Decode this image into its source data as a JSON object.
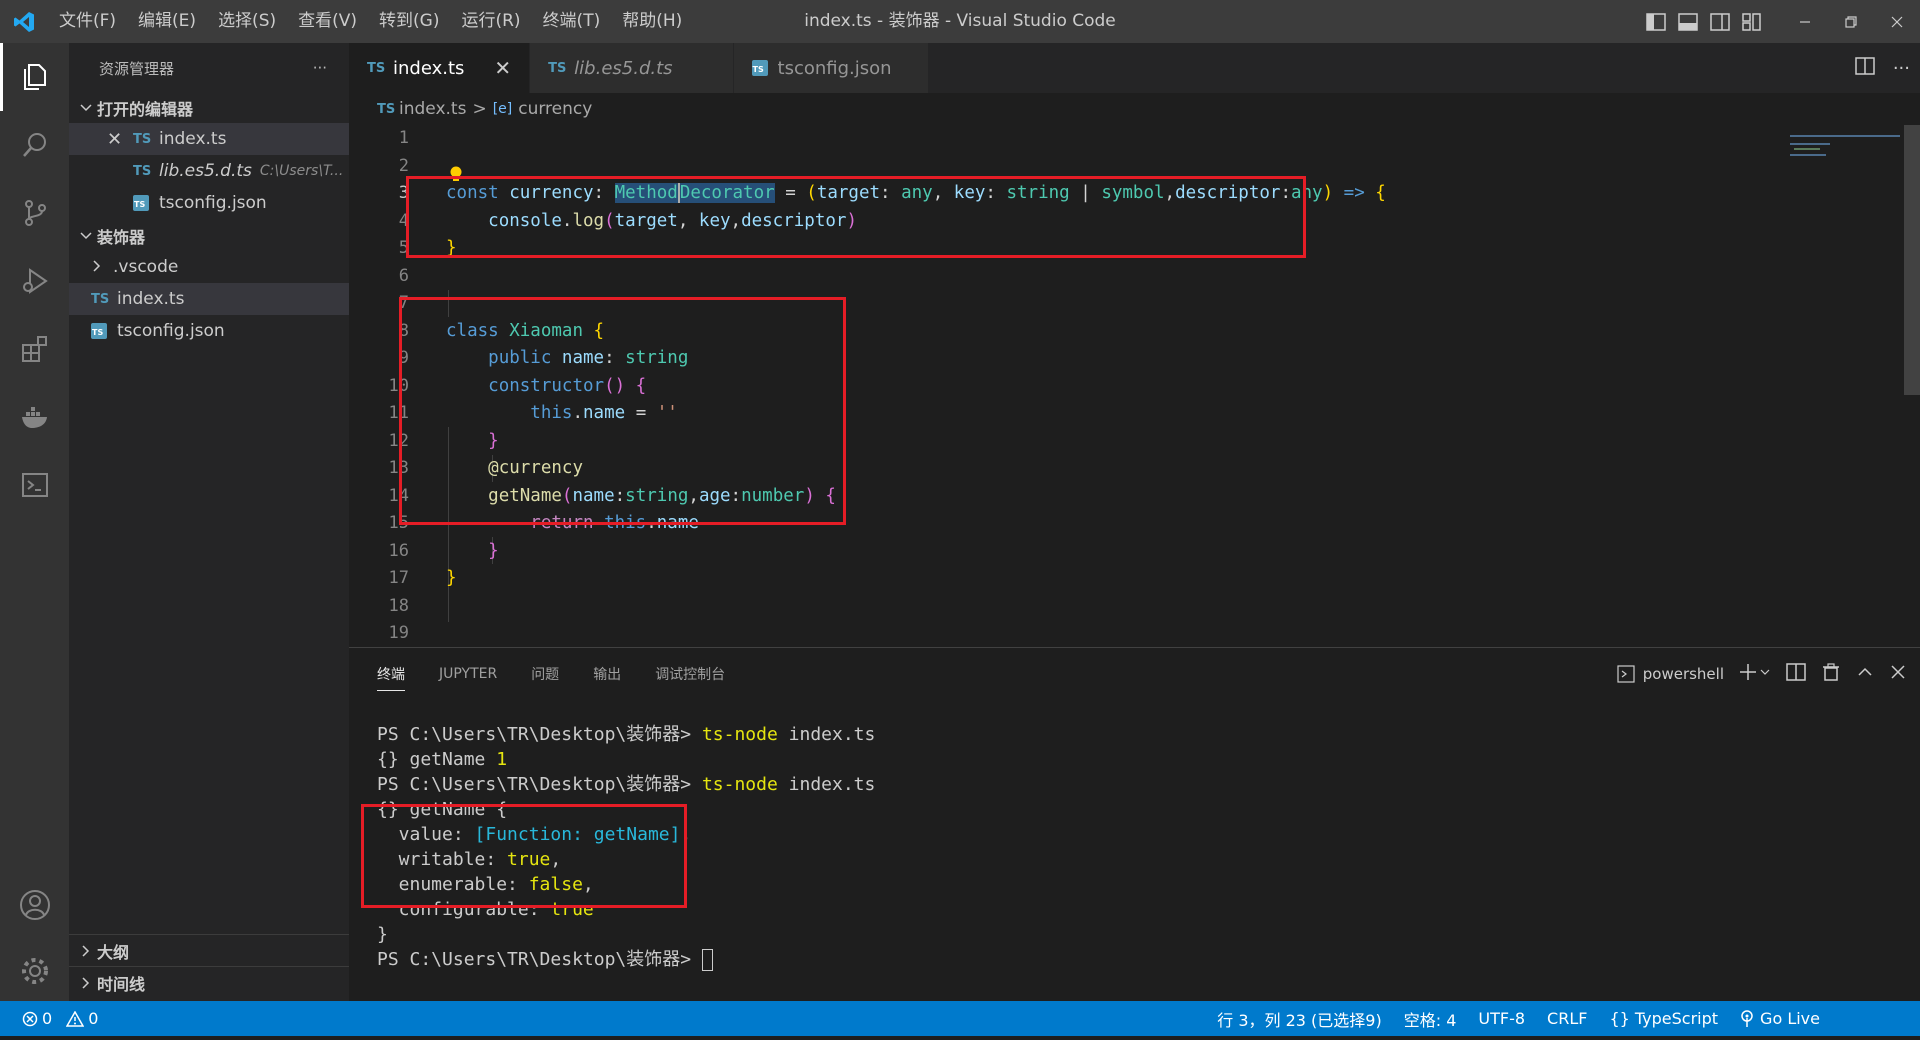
{
  "menu": [
    "文件(F)",
    "编辑(E)",
    "选择(S)",
    "查看(V)",
    "转到(G)",
    "运行(R)",
    "终端(T)",
    "帮助(H)"
  ],
  "window_title": "index.ts - 装饰器 - Visual Studio Code",
  "sidebar": {
    "title": "资源管理器",
    "more": "···",
    "open_editors": {
      "header": "打开的编辑器",
      "items": [
        {
          "badge": "TS",
          "name": "index.ts",
          "path": ""
        },
        {
          "badge": "TS",
          "name": "lib.es5.d.ts",
          "path": "C:\\Users\\T..."
        },
        {
          "badge": "",
          "name": "tsconfig.json",
          "path": ""
        }
      ]
    },
    "folder": {
      "header": "装饰器",
      "items": [
        {
          "badge": "",
          "name": ".vscode"
        },
        {
          "badge": "TS",
          "name": "index.ts"
        },
        {
          "badge": "",
          "name": "tsconfig.json"
        }
      ]
    },
    "outline": "大纲",
    "timeline": "时间线"
  },
  "tabs": [
    {
      "badge": "TS",
      "label": "index.ts",
      "close": "✕"
    },
    {
      "badge": "TS",
      "label": "lib.es5.d.ts"
    },
    {
      "badge": "",
      "label": "tsconfig.json"
    }
  ],
  "breadcrumb": {
    "badge": "TS",
    "file": "index.ts",
    "sep": ">",
    "symbol_icon": "[e]",
    "symbol": "currency"
  },
  "line_numbers": [
    "1",
    "2",
    "3",
    "4",
    "5",
    "6",
    "7",
    "8",
    "9",
    "10",
    "11",
    "12",
    "13",
    "14",
    "15",
    "16",
    "17",
    "18",
    "19"
  ],
  "code": {
    "l3": {
      "a": "const",
      "b": "currency",
      "c": ": ",
      "d": "Method",
      "e": "Decorator",
      "f": " = ",
      "g": "(",
      "h": "target",
      "i": ": ",
      "j": "any",
      "k": ", ",
      "l": "key",
      "m": ": ",
      "n": "string",
      "o": " | ",
      "p": "symbol",
      "q": ",",
      "r": "descriptor",
      "s": ":",
      "t": "any",
      "u": ")",
      "v": " => ",
      "w": "{"
    },
    "l4": {
      "a": "console",
      "b": ".",
      "c": "log",
      "d": "(",
      "e": "target",
      "f": ", ",
      "g": "key",
      "h": ",",
      "i": "descriptor",
      "j": ")"
    },
    "l5": {
      "a": "}"
    },
    "l8": {
      "a": "class",
      "b": "Xiaoman",
      "c": "{"
    },
    "l9": {
      "a": "public",
      "b": "name",
      "c": ": ",
      "d": "string"
    },
    "l10": {
      "a": "constructor",
      "b": "()",
      "c": " {"
    },
    "l11": {
      "a": "this",
      "b": ".",
      "c": "name",
      "d": " = ",
      "e": "''"
    },
    "l12": {
      "a": "}"
    },
    "l13": {
      "a": "@",
      "b": "currency"
    },
    "l14": {
      "a": "getName",
      "b": "(",
      "c": "name",
      "d": ":",
      "e": "string",
      "f": ",",
      "g": "age",
      "h": ":",
      "i": "number",
      "j": ")",
      "k": " {"
    },
    "l15": {
      "a": "return",
      "b": "this",
      "c": ".",
      "d": "name"
    },
    "l16": {
      "a": "}"
    },
    "l17": {
      "a": "}"
    }
  },
  "panel": {
    "tabs": [
      "终端",
      "JUPYTER",
      "问题",
      "输出",
      "调试控制台"
    ],
    "shell": "powershell",
    "terminal": {
      "prompt": "PS C:\\Users\\TR\\Desktop\\装饰器>",
      "cmd1": "ts-node",
      "arg1": "index.ts",
      "out1a": "{} getName",
      "out1b": "1",
      "cmd2": "ts-node",
      "arg2": "index.ts",
      "out2": "{} getName {",
      "value_key": "  value: ",
      "value_val": "[Function: getName]",
      "comma": ",",
      "writable_key": "  writable: ",
      "writable_val": "true",
      "enumerable_key": "  enumerable: ",
      "enumerable_val": "false",
      "configurable_key": "  configurable: ",
      "configurable_val": "true",
      "close": "}"
    }
  },
  "status": {
    "errors": "0",
    "warnings": "0",
    "position": "行 3，列 23 (已选择9)",
    "spaces": "空格: 4",
    "encoding": "UTF-8",
    "eol": "CRLF",
    "language_icon": "{}",
    "language": "TypeScript",
    "golive": "Go Live"
  },
  "colors": {
    "accent": "#007acc",
    "highlight_box": "#e51d26"
  }
}
